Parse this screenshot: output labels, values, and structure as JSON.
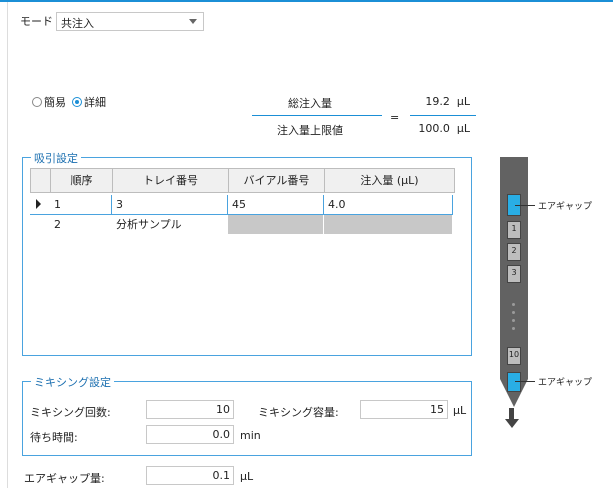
{
  "mode": {
    "label": "モード",
    "value": "共注入"
  },
  "view": {
    "simple_label": "簡易",
    "detail_label": "詳細",
    "selected": "詳細"
  },
  "injection": {
    "total_label": "総注入量",
    "total_value": "19.2",
    "total_unit": "μL",
    "equals": "=",
    "limit_label": "注入量上限値",
    "limit_value": "100.0",
    "limit_unit": "μL"
  },
  "aspiration": {
    "title": "吸引設定",
    "columns": [
      "順序",
      "トレイ番号",
      "バイアル番号",
      "注入量 (μL)"
    ],
    "rows": [
      {
        "order": "1",
        "tray": "3",
        "vial": "45",
        "volume": "4.0"
      },
      {
        "order": "2",
        "tray": "分析サンプル",
        "vial": "",
        "volume": ""
      }
    ]
  },
  "mixing": {
    "title": "ミキシング設定",
    "count_label": "ミキシング回数:",
    "count_value": "10",
    "volume_label": "ミキシング容量:",
    "volume_value": "15",
    "volume_unit": "μL",
    "wait_label": "待ち時間:",
    "wait_value": "0.0",
    "wait_unit": "min"
  },
  "air_gap": {
    "label": "エアギャップ量:",
    "value": "0.1",
    "unit": "μL"
  },
  "diagram": {
    "top_label": "エアギャップ",
    "bottom_label": "エアギャップ",
    "segments": [
      "1",
      "2",
      "3",
      "10"
    ]
  }
}
